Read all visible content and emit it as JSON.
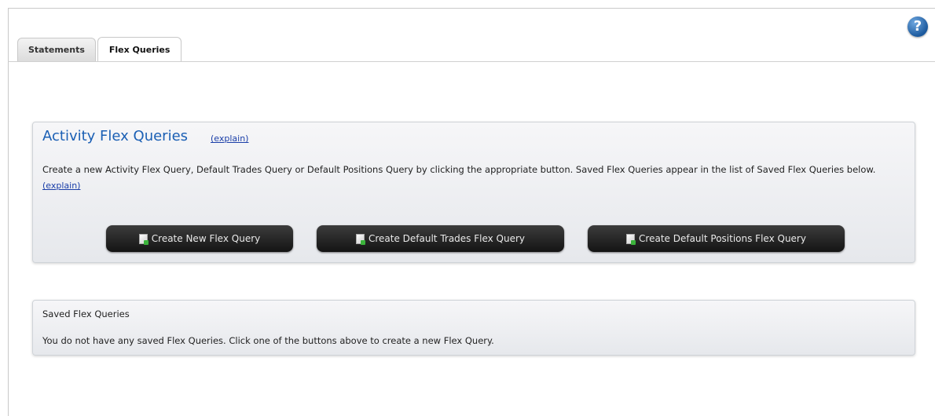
{
  "tabs": [
    {
      "label": "Statements",
      "active": false
    },
    {
      "label": "Flex Queries",
      "active": true
    }
  ],
  "help_icon": {
    "glyph": "?",
    "icon": "help-icon",
    "color": "#1c5a9e"
  },
  "activity": {
    "title": "Activity Flex Queries",
    "title_explain": "(explain)",
    "description": "Create a new Activity Flex Query, Default Trades Query or Default Positions Query by clicking the appropriate button. Saved Flex Queries appear in the list of Saved Flex Queries below.",
    "description_explain": "(explain)",
    "buttons": {
      "create_new": "Create New Flex Query",
      "create_trades": "Create Default Trades Flex Query",
      "create_positions": "Create Default Positions Flex Query"
    }
  },
  "saved": {
    "title": "Saved Flex Queries",
    "message": "You do not have any saved Flex Queries. Click one of the buttons above to create a new Flex Query."
  },
  "colors": {
    "title_blue": "#1a5fb4",
    "link_blue": "#1a3ea8",
    "button_dark": "#141414"
  }
}
